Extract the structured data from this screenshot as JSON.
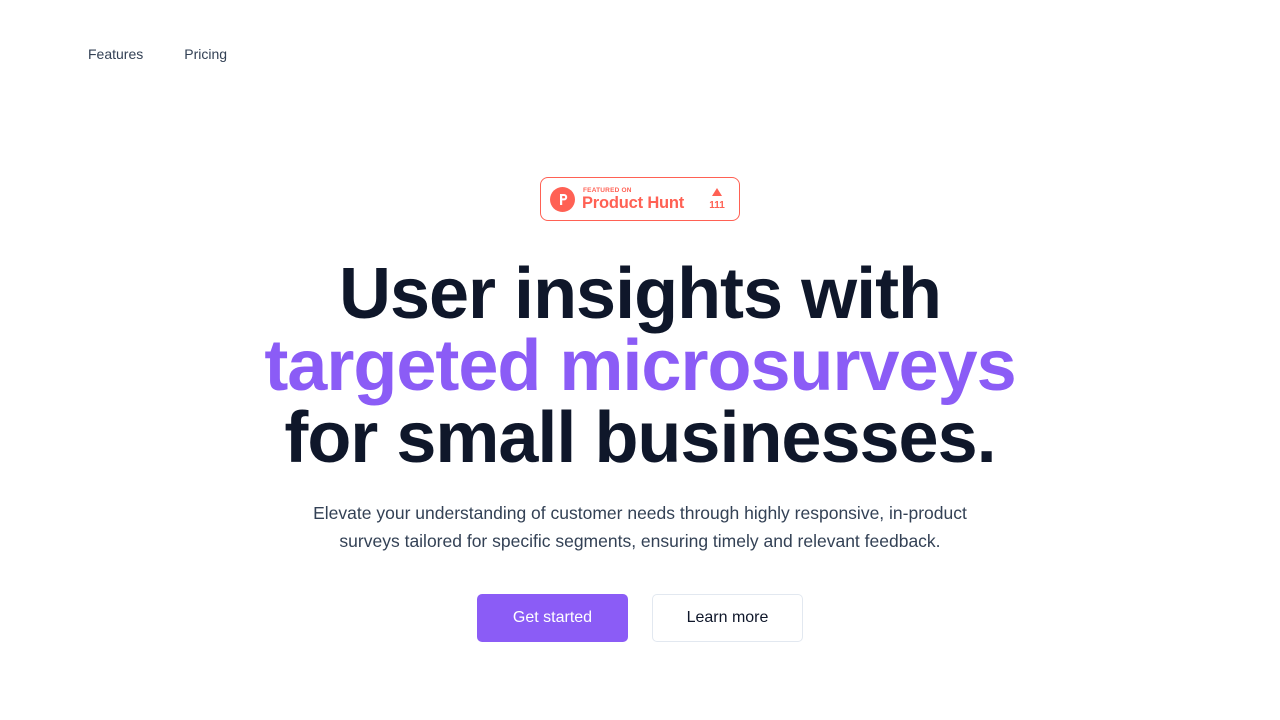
{
  "nav": {
    "items": [
      {
        "label": "Features"
      },
      {
        "label": "Pricing"
      }
    ]
  },
  "badge": {
    "small_text": "FEATURED ON",
    "big_text": "Product Hunt",
    "count": "111",
    "logo_letter": "P",
    "color": "#ff6154"
  },
  "hero": {
    "line1": "User insights with",
    "line2": "targeted microsurveys",
    "line3": "for small businesses.",
    "subtitle": "Elevate your understanding of customer needs through highly responsive, in-product surveys tailored for specific segments, ensuring timely and relevant feedback.",
    "accent_color": "#8b5cf6"
  },
  "cta": {
    "primary_label": "Get started",
    "secondary_label": "Learn more"
  }
}
